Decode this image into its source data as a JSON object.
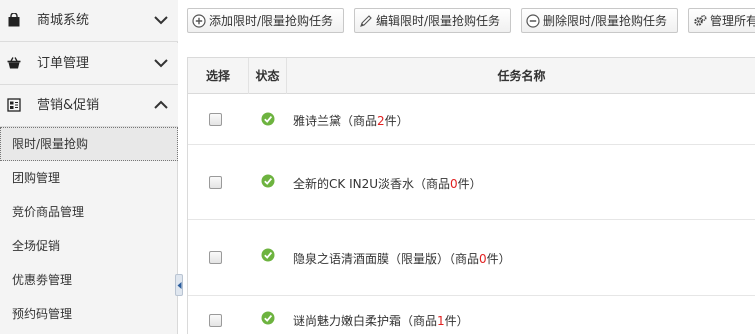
{
  "sidebar": {
    "menus": [
      {
        "label": "商城系统",
        "icon": "shopping-bag-icon",
        "chevron": "chevron-down-icon"
      },
      {
        "label": "订单管理",
        "icon": "basket-icon",
        "chevron": "chevron-down-icon"
      },
      {
        "label": "营销&促销",
        "icon": "promotion-icon",
        "chevron": "chevron-up-icon"
      }
    ],
    "items": [
      {
        "label": "限时/限量抢购",
        "active": true
      },
      {
        "label": "团购管理"
      },
      {
        "label": "竞价商品管理"
      },
      {
        "label": "全场促销"
      },
      {
        "label": "优惠劵管理"
      },
      {
        "label": "预约码管理"
      }
    ]
  },
  "toolbar": {
    "buttons": [
      {
        "label": "添加限时/限量抢购任务",
        "icon": "plus-circle-icon"
      },
      {
        "label": "编辑限时/限量抢购任务",
        "icon": "pencil-icon"
      },
      {
        "label": "删除限时/限量抢购任务",
        "icon": "minus-circle-icon"
      },
      {
        "label": "管理所有",
        "icon": "gear-icon"
      }
    ]
  },
  "table": {
    "columns": [
      "选择",
      "状态",
      "任务名称"
    ],
    "rows": [
      {
        "name": "雅诗兰黛",
        "count_prefix": "（商品",
        "count": "2",
        "count_suffix": "件）",
        "status": "enabled"
      },
      {
        "name": "全新的CK IN2U淡香水",
        "count_prefix": "（商品",
        "count": "0",
        "count_suffix": "件）",
        "status": "enabled"
      },
      {
        "name": "隐泉之语清酒面膜（限量版）",
        "count_prefix": "（商品",
        "count": "0",
        "count_suffix": "件）",
        "status": "enabled"
      },
      {
        "name": "谜尚魅力嫩白柔护霜",
        "count_prefix": "（商品",
        "count": "1",
        "count_suffix": "件）",
        "status": "enabled"
      }
    ]
  },
  "colors": {
    "accent_red": "#e02020",
    "status_green": "#6db33f"
  }
}
